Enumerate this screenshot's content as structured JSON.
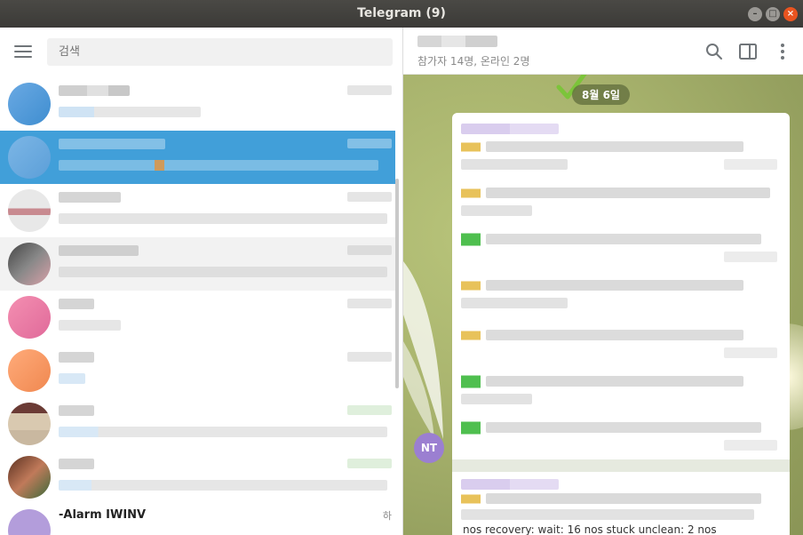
{
  "window": {
    "title": "Telegram (9)",
    "controls": {
      "minimize": "–",
      "maximize": "□",
      "close": "×"
    }
  },
  "sidebar": {
    "search_placeholder": "검색",
    "last_chat": {
      "name": "-Alarm IWINV",
      "time": "하"
    }
  },
  "chat": {
    "members": "참가자 14명, 온라인 2명",
    "date_label": "8월 6일",
    "sender_initials": "NT",
    "preview_text": "nos recovery: wait: 16 nos stuck unclean: 2 nos"
  },
  "colors": {
    "accent": "#419fd9",
    "titlebar": "#3b3a37",
    "close": "#e95420",
    "sender_avatar": "#9b7fd1"
  },
  "icons": {
    "menu": "hamburger-icon",
    "search": "search-icon",
    "panel": "sidebar-panel-icon",
    "more": "more-vertical-icon"
  }
}
